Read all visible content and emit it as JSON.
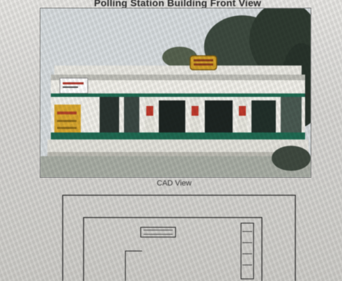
{
  "page": {
    "title": "Polling Station Building Front View",
    "cad_caption": "CAD View"
  },
  "photo": {
    "description_icon": "building-photo"
  },
  "colors": {
    "background": "#dcdcda",
    "photo_sky": "#d8dde0",
    "building_wall": "#f1f0ea",
    "trim_green": "#1f6a52",
    "door_dark": "#1d2522",
    "sign_yellow": "#d2a12a",
    "cad_line": "#1e1e1e"
  }
}
